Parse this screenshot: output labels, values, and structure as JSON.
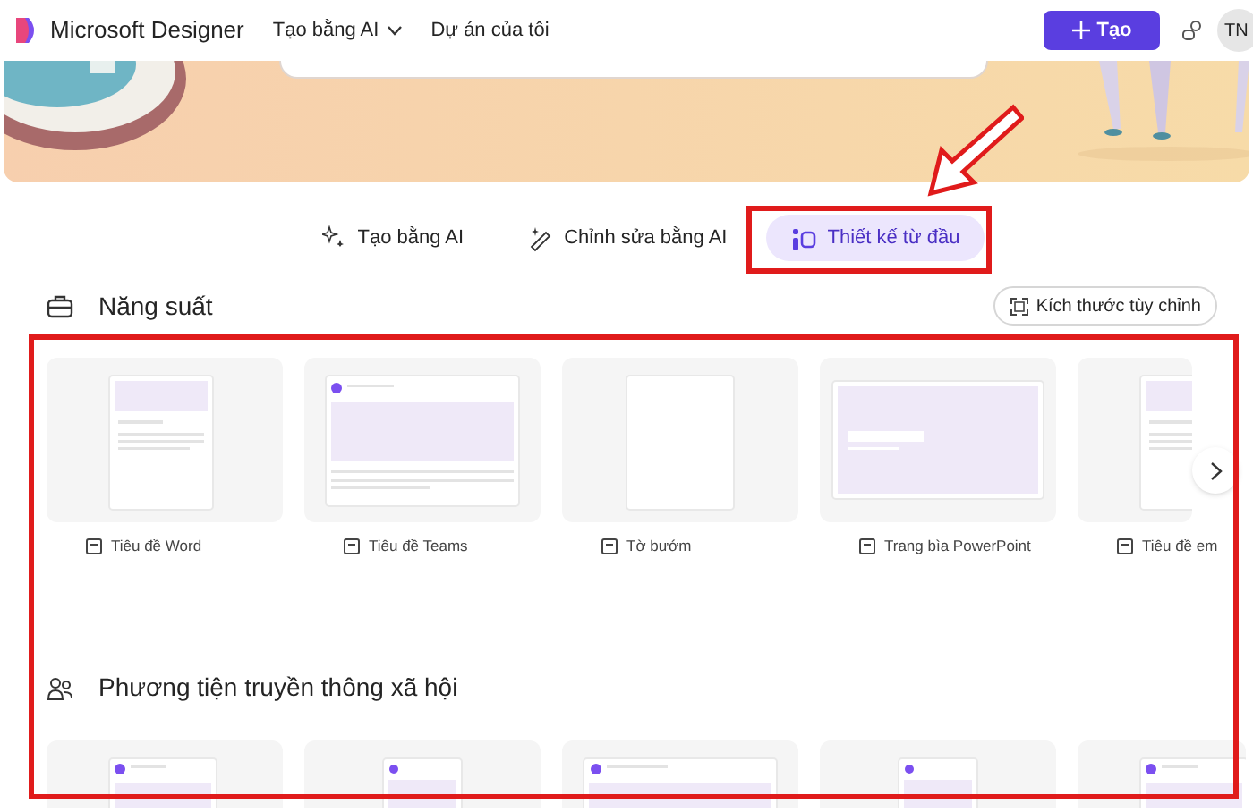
{
  "header": {
    "app_name": "Microsoft Designer",
    "nav": [
      {
        "label": "Tạo bằng AI",
        "dropdown": true
      },
      {
        "label": "Dự án của tôi",
        "dropdown": false
      }
    ],
    "create_button": "Tạo",
    "avatar": "TN"
  },
  "tabs": [
    {
      "label": "Tạo bằng AI",
      "selected": false
    },
    {
      "label": "Chỉnh sửa bằng AI",
      "selected": false
    },
    {
      "label": "Thiết kế từ đầu",
      "selected": true
    }
  ],
  "sections": [
    {
      "title": "Năng suất",
      "action": "Kích thước tùy chỉnh",
      "templates": [
        {
          "kind": "doc",
          "label": "Tiêu đề Word"
        },
        {
          "kind": "teams",
          "label": "Tiêu đề Teams"
        },
        {
          "kind": "blank",
          "label": "Tờ bướm"
        },
        {
          "kind": "slide",
          "label": "Trang bìa PowerPoint"
        },
        {
          "kind": "doc",
          "label": "Tiêu đề em"
        }
      ]
    },
    {
      "title": "Phương tiện truyền thông xã hội",
      "templates": [
        {
          "kind": "post"
        },
        {
          "kind": "story"
        },
        {
          "kind": "wide"
        },
        {
          "kind": "story"
        },
        {
          "kind": "post"
        }
      ]
    }
  ]
}
